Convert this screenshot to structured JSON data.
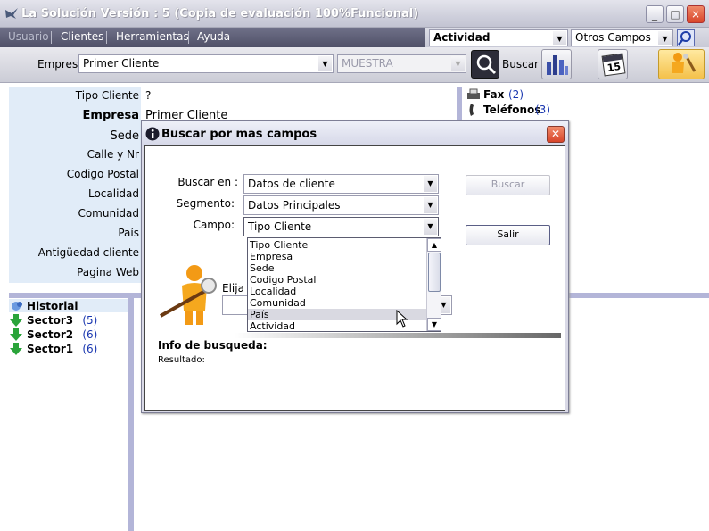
{
  "window": {
    "title": "La Solución  Versión :  5 (Copia de evaluación 100%Funcional)",
    "controls": {
      "minimize": "_",
      "maximize": "□",
      "close": "×"
    }
  },
  "menu": {
    "items": [
      {
        "label": "Usuario",
        "state": "disabled"
      },
      {
        "label": "Clientes"
      },
      {
        "label": "Herramientas"
      },
      {
        "label": "Ayuda"
      }
    ]
  },
  "filters": {
    "actividad": "Actividad",
    "otros_campos": "Otros Campos"
  },
  "toolbar": {
    "empresa_label": "Empresa",
    "empresa_value": "Primer Cliente",
    "muestra_value": "MUESTRA",
    "buscar_label": "Buscar",
    "calendar_day": "15"
  },
  "client_fields": [
    {
      "label": "Tipo Cliente",
      "value": "?"
    },
    {
      "label": "Empresa",
      "value": "Primer Cliente"
    },
    {
      "label": "Sede",
      "value": ""
    },
    {
      "label": "Calle y Nr",
      "value": ""
    },
    {
      "label": "Codigo Postal",
      "value": ""
    },
    {
      "label": "Localidad",
      "value": ""
    },
    {
      "label": "Comunidad",
      "value": ""
    },
    {
      "label": "País",
      "value": ""
    },
    {
      "label": "Antigüedad cliente",
      "value": ""
    },
    {
      "label": "Pagina Web",
      "value": ""
    }
  ],
  "contacts": [
    {
      "label": "Fax",
      "count": "(2)"
    },
    {
      "label": "Teléfonos",
      "count": "(3)"
    }
  ],
  "tree": [
    {
      "label": "Historial",
      "count": ""
    },
    {
      "label": "Sector3",
      "count": "(5)"
    },
    {
      "label": "Sector2",
      "count": "(6)"
    },
    {
      "label": "Sector1",
      "count": "(6)"
    }
  ],
  "dialog": {
    "title": "Buscar por mas campos",
    "buscar_en_label": "Buscar en :",
    "buscar_en_value": "Datos de cliente",
    "segmento_label": "Segmento:",
    "segmento_value": "Datos Principales",
    "campo_label": "Campo:",
    "campo_value": "Tipo Cliente",
    "buscar_button": "Buscar",
    "salir_button": "Salir",
    "elija_label": "Elija",
    "options": [
      "Tipo Cliente",
      "Empresa",
      "Sede",
      "Codigo Postal",
      "Localidad",
      "Comunidad",
      "País",
      "Actividad"
    ],
    "hovered_option": "País",
    "info_title": "Info de busqueda:",
    "resultado_label": "Resultado:"
  },
  "colors": {
    "accent": "#b3b5d8",
    "panel": "#e1ecf8",
    "menubar": "#5c5d75",
    "link": "#1a37b0"
  }
}
